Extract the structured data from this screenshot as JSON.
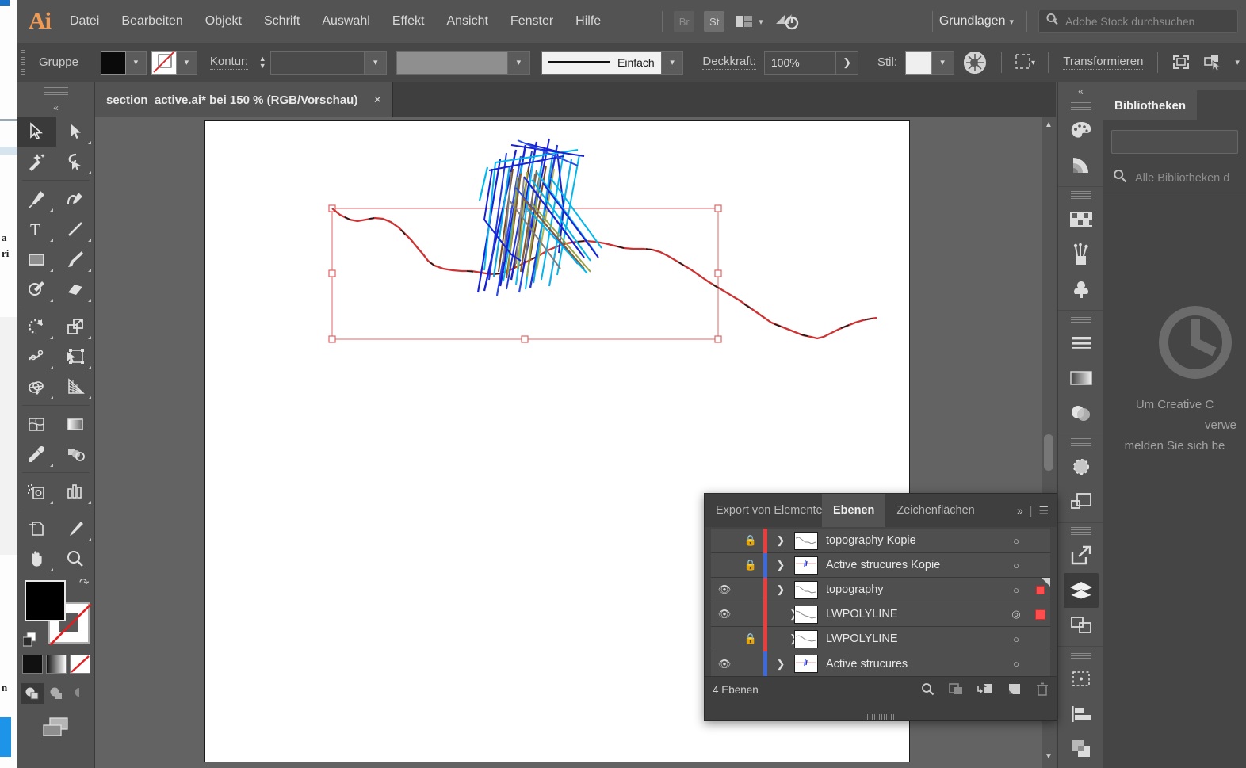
{
  "app": {
    "name": "Adobe Illustrator",
    "logo": "Ai"
  },
  "menubar": {
    "items": [
      "Datei",
      "Bearbeiten",
      "Objekt",
      "Schrift",
      "Auswahl",
      "Effekt",
      "Ansicht",
      "Fenster",
      "Hilfe"
    ],
    "bridge_label": "Br",
    "stock_label": "St",
    "arrange_icon": "arrange-documents-icon",
    "workspace": "Grundlagen",
    "search_placeholder": "Adobe Stock durchsuchen"
  },
  "controlbar": {
    "selection_label": "Gruppe",
    "fill_label": "fill-swatch",
    "stroke_label": "Kontur:",
    "stroke_weight": "",
    "stroke_profile": "",
    "brush_label": "Einfach",
    "opacity_label": "Deckkraft:",
    "opacity_value": "100%",
    "style_label": "Stil:",
    "recolor_icon": "recolor-artwork-icon",
    "align_icon": "align-icon",
    "transform_label": "Transformieren",
    "isolate_icon": "isolate-selected-icon",
    "select_similar_icon": "select-similar-objects-icon"
  },
  "document": {
    "tab_title": "section_active.ai* bei 150 % (RGB/Vorschau)",
    "close_label": "×"
  },
  "toolbar": {
    "collapse_label": "«",
    "tools": [
      {
        "name": "selection-tool",
        "glyph": "selection",
        "selected": true
      },
      {
        "name": "direct-selection-tool",
        "glyph": "direct-selection",
        "selected": false
      },
      {
        "name": "magic-wand-tool",
        "glyph": "magic-wand",
        "selected": false
      },
      {
        "name": "lasso-tool",
        "glyph": "lasso",
        "selected": false
      },
      {
        "name": "pen-tool",
        "glyph": "pen",
        "selected": false
      },
      {
        "name": "curvature-tool",
        "glyph": "curvature",
        "selected": false
      },
      {
        "name": "type-tool",
        "glyph": "type",
        "selected": false
      },
      {
        "name": "line-segment-tool",
        "glyph": "line",
        "selected": false
      },
      {
        "name": "rectangle-tool",
        "glyph": "rectangle",
        "selected": false
      },
      {
        "name": "paintbrush-tool",
        "glyph": "paintbrush",
        "selected": false
      },
      {
        "name": "shaper-tool",
        "glyph": "shaper",
        "selected": false
      },
      {
        "name": "eraser-tool",
        "glyph": "eraser",
        "selected": false
      },
      {
        "name": "rotate-tool",
        "glyph": "rotate",
        "selected": false
      },
      {
        "name": "scale-tool",
        "glyph": "scale",
        "selected": false
      },
      {
        "name": "width-tool",
        "glyph": "width",
        "selected": false
      },
      {
        "name": "free-transform-tool",
        "glyph": "free-transform",
        "selected": false
      },
      {
        "name": "shape-builder-tool",
        "glyph": "shape-builder",
        "selected": false
      },
      {
        "name": "perspective-grid-tool",
        "glyph": "perspective-grid",
        "selected": false
      },
      {
        "name": "mesh-tool",
        "glyph": "mesh",
        "selected": false
      },
      {
        "name": "gradient-tool",
        "glyph": "gradient",
        "selected": false
      },
      {
        "name": "eyedropper-tool",
        "glyph": "eyedropper",
        "selected": false
      },
      {
        "name": "blend-tool",
        "glyph": "blend",
        "selected": false
      },
      {
        "name": "symbol-sprayer-tool",
        "glyph": "symbol-sprayer",
        "selected": false
      },
      {
        "name": "column-graph-tool",
        "glyph": "column-graph",
        "selected": false
      },
      {
        "name": "artboard-tool",
        "glyph": "artboard",
        "selected": false
      },
      {
        "name": "slice-tool",
        "glyph": "slice",
        "selected": false
      },
      {
        "name": "hand-tool",
        "glyph": "hand",
        "selected": false
      },
      {
        "name": "zoom-tool",
        "glyph": "zoom",
        "selected": false
      }
    ],
    "fill_color": "#000000",
    "stroke_color": "#ffffff",
    "swap_icon": "swap-fill-stroke-icon",
    "default_icon": "default-fill-stroke-icon",
    "modes": [
      "color-mode",
      "gradient-mode",
      "none-mode"
    ],
    "draw_modes": [
      "draw-normal",
      "draw-behind",
      "draw-inside"
    ],
    "screen_mode": "change-screen-mode-icon"
  },
  "canvas": {
    "zoom": "150 %",
    "artwork_name": "geological-cross-section",
    "topography_color": "#cc3333",
    "structures_colors": [
      "#1122dd",
      "#00a0e8",
      "#2a6fd6",
      "#8a6a2a",
      "#7a3a2a",
      "#9aa05a",
      "#6f6f6f"
    ],
    "selection_color": "#e06464"
  },
  "layers_panel": {
    "tabs": [
      {
        "label": "Export von Elementen",
        "active": false
      },
      {
        "label": "Ebenen",
        "active": true
      },
      {
        "label": "Zeichenflächen",
        "active": false
      }
    ],
    "overflow_label": "»",
    "menu_icon": "panel-menu-icon",
    "rows": [
      {
        "name": "topography Kopie",
        "visible": false,
        "locked": true,
        "color": "#ee3b3b",
        "expanded": false,
        "indent": 0,
        "thumb": "topography-thumb",
        "target": "target-circle",
        "selected": false,
        "selection_big": false
      },
      {
        "name": "Active strucures Kopie",
        "visible": false,
        "locked": true,
        "color": "#3b6ae0",
        "expanded": false,
        "indent": 0,
        "thumb": "structures-thumb",
        "target": "target-circle",
        "selected": false,
        "selection_big": false
      },
      {
        "name": "topography",
        "visible": true,
        "locked": false,
        "color": "#ee3b3b",
        "expanded": true,
        "indent": 0,
        "thumb": "topography-thumb",
        "target": "target-circle",
        "selected": true,
        "selection_big": false
      },
      {
        "name": "LWPOLYLINE",
        "visible": true,
        "locked": false,
        "color": "#ee3b3b",
        "expanded": false,
        "indent": 1,
        "thumb": "topography-thumb",
        "target": "target-circle-double",
        "selected": true,
        "selection_big": true
      },
      {
        "name": "LWPOLYLINE",
        "visible": false,
        "locked": true,
        "color": "#ee3b3b",
        "expanded": false,
        "indent": 1,
        "thumb": "topography-thumb",
        "target": "target-circle",
        "selected": false,
        "selection_big": false
      },
      {
        "name": "Active strucures",
        "visible": true,
        "locked": false,
        "color": "#3b6ae0",
        "expanded": false,
        "indent": 0,
        "thumb": "structures-thumb",
        "target": "target-circle",
        "selected": false,
        "selection_big": false
      }
    ],
    "footer": {
      "count_label": "4 Ebenen",
      "icons": [
        {
          "name": "locate-object-icon",
          "dim": false
        },
        {
          "name": "make-clipping-mask-icon",
          "dim": true
        },
        {
          "name": "create-new-sublayer-icon",
          "dim": false
        },
        {
          "name": "create-new-layer-icon",
          "dim": false
        },
        {
          "name": "delete-selection-icon",
          "dim": true
        }
      ]
    }
  },
  "right_dock": {
    "collapse_label": "«",
    "groups": [
      [
        "color-panel-icon",
        "color-guide-panel-icon"
      ],
      [
        "swatches-panel-icon",
        "brushes-panel-icon",
        "symbols-panel-icon"
      ],
      [
        "stroke-panel-icon",
        "gradient-panel-icon",
        "transparency-panel-icon"
      ],
      [
        "appearance-panel-icon",
        "graphic-styles-panel-icon"
      ],
      [
        "asset-export-panel-icon",
        "layers-panel-icon",
        "artboards-panel-icon"
      ],
      [
        "transform-panel-icon",
        "align-panel-icon",
        "pathfinder-panel-icon"
      ]
    ],
    "selected": "layers-panel-icon"
  },
  "libraries_panel": {
    "tab_label": "Bibliotheken",
    "library_select_value": "",
    "search_placeholder": "Alle Bibliotheken d",
    "empty_lines": [
      "Um Creative C",
      "verwe",
      "melden Sie sich be"
    ],
    "cc_icon": "creative-cloud-icon"
  }
}
